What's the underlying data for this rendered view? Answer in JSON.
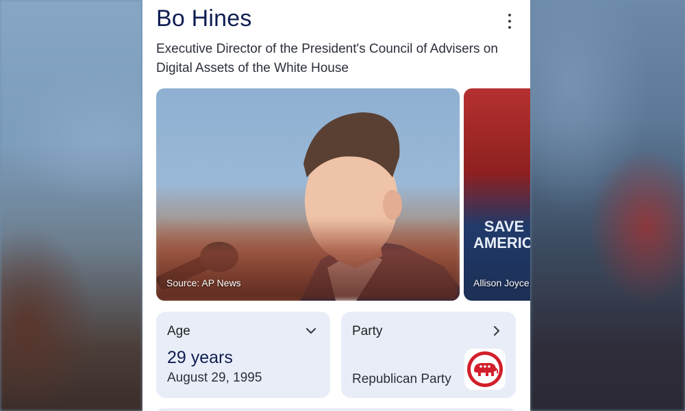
{
  "entity": {
    "name": "Bo Hines",
    "description": "Executive Director of the President's Council of Advisers on Digital Assets of the White House"
  },
  "images": [
    {
      "caption": "Source: AP News"
    },
    {
      "caption": "Allison Joyce",
      "sign_text": "SAVE AMERICA"
    }
  ],
  "attributes": {
    "age": {
      "label": "Age",
      "value": "29 years",
      "detail": "August 29, 1995",
      "icon": "chevron-down-icon"
    },
    "party": {
      "label": "Party",
      "value": "Republican Party",
      "icon": "chevron-right-icon",
      "logo": "republican-elephant-logo"
    }
  },
  "colors": {
    "title": "#0f1d52",
    "chip_bg": "#e8edf7",
    "party_red": "#d21f2b"
  }
}
